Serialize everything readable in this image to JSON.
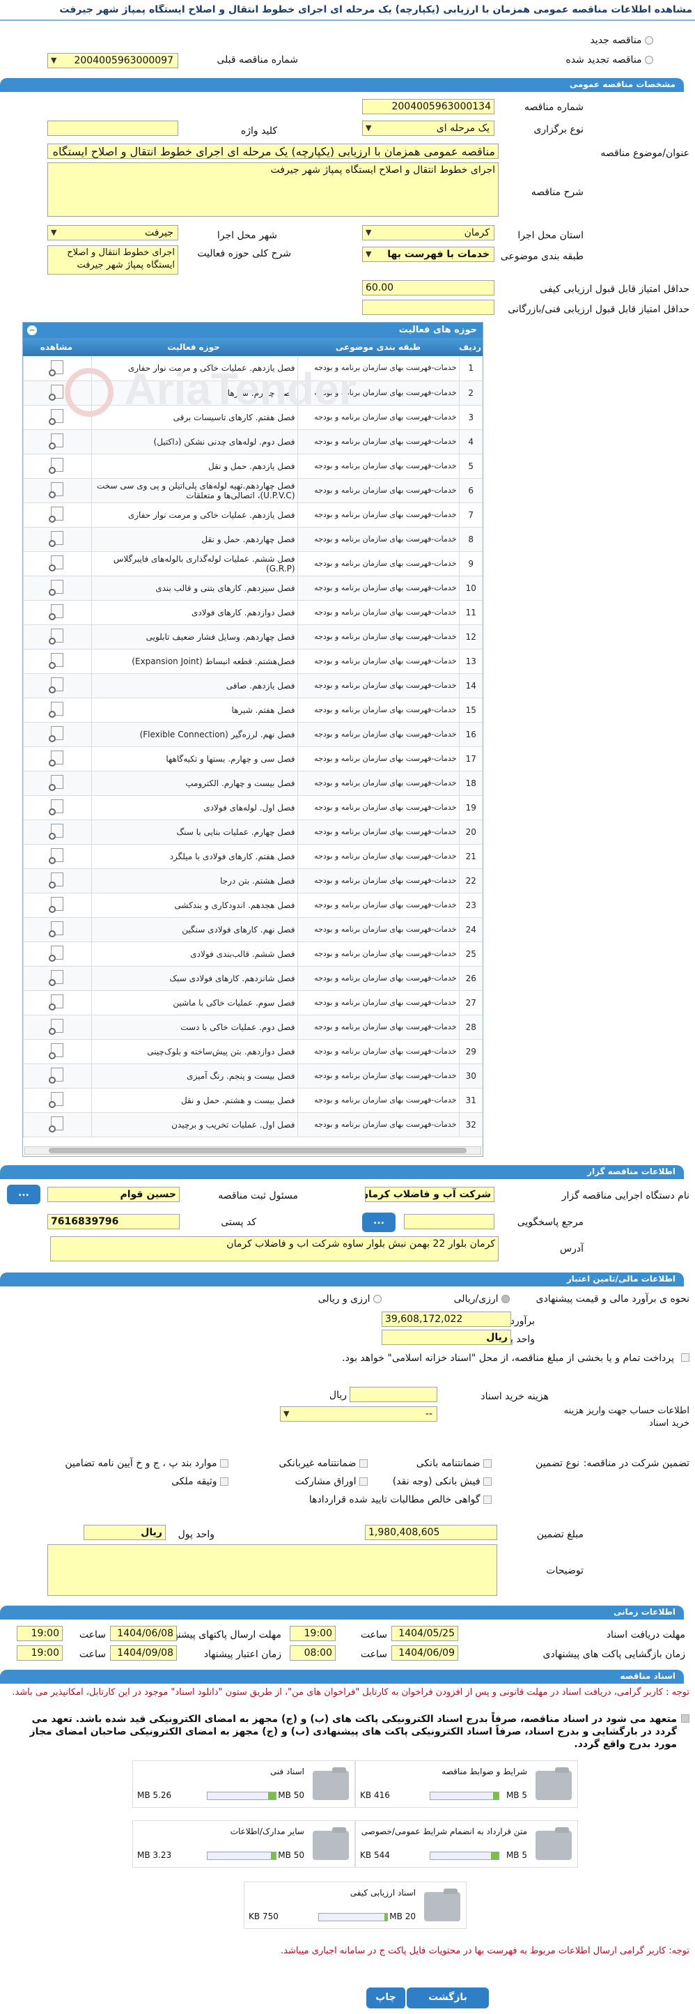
{
  "page_title": "مشاهده اطلاعات مناقصه عمومی همزمان با ارزیابی (یکپارچه) یک مرحله ای اجرای خطوط انتقال و اصلاح ایستگاه پمپاژ شهر جیرفت",
  "top": {
    "new_tender": "مناقصه جدید",
    "renewed_tender": "مناقصه تجدید شده",
    "prev_number_label": "شماره مناقصه قبلی",
    "prev_number_value": "2004005963000097"
  },
  "general": {
    "header": "مشخصات مناقصه عمومی",
    "number_label": "شماره مناقصه",
    "number_value": "2004005963000134",
    "type_label": "نوع برگزاری",
    "type_value": "یک مرحله ای",
    "keyword_label": "کلید واژه",
    "keyword_value": "",
    "title_label": "عنوان/موضوع مناقصه",
    "title_value": "مناقصه عمومی همزمان با ارزیابی (یکپارچه) یک مرحله ای اجرای خطوط انتقال و اصلاح ایستگاه",
    "desc_label": "شرح مناقصه",
    "desc_value": "اجرای خطوط انتقال و اصلاح ایستگاه پمپاژ شهر جیرفت",
    "province_label": "استان محل اجرا",
    "province_value": "کرمان",
    "city_label": "شهر محل اجرا",
    "city_value": "جیرفت",
    "category_label": "طبقه بندی موضوعی",
    "category_value": "خدمات با فهرست بها",
    "scope_label": "شرح کلی حوزه فعالیت",
    "scope_value": "اجرای خطوط انتقال و اصلاح ایستگاه پمپاژ شهر جیرفت",
    "min_quality_label": "حداقل امتیاز قابل قبول ارزیابی کیفی",
    "min_quality_value": "60.00",
    "min_tech_label": "حداقل امتیاز قابل قبول ارزیابی فنی/بازرگانی",
    "min_tech_value": ""
  },
  "activity": {
    "header": "حوزه های فعالیت",
    "col_row": "ردیف",
    "col_cat": "طبقه بندی موضوعی",
    "col_field": "حوزه فعالیت",
    "col_view": "مشاهده",
    "cat_text": "خدمات-فهرست بهای سازمان برنامه و بودجه",
    "rows": [
      {
        "n": "1",
        "f": "فصل یازدهم. عملیات خاکی و مرمت نوار حفاری"
      },
      {
        "n": "2",
        "f": "فصل چهارم. شیرها"
      },
      {
        "n": "3",
        "f": "فصل هفتم. کارهای تاسیسات برقی"
      },
      {
        "n": "4",
        "f": "فصل دوم. لوله‌های چدنی نشکن (داکتیل)"
      },
      {
        "n": "5",
        "f": "فصل یازدهم. حمل و نقل"
      },
      {
        "n": "6",
        "f": "فصل چهاردهم.تهیه لوله‌های پلی‌اتیلن و پی وی سی سخت (U.P.V.C)، اتصالی‌ها و متعلقات"
      },
      {
        "n": "7",
        "f": "فصل یازدهم. عملیات خاکی و مرمت نوار حفاری"
      },
      {
        "n": "8",
        "f": "فصل چهاردهم. حمل و نقل"
      },
      {
        "n": "9",
        "f": "فصل ششم. عملیات لوله‌گذاری بالوله‌های فایبرگلاس (G.R.P)"
      },
      {
        "n": "10",
        "f": "فصل سیزدهم. کارهای بتنی و قالب بندی"
      },
      {
        "n": "11",
        "f": "فصل دوازدهم. کارهای فولادی"
      },
      {
        "n": "12",
        "f": "فصل چهاردهم. وسایل فشار ضعیف تابلویی"
      },
      {
        "n": "13",
        "f": "فصل‌هشتم. قطعه انبساط (Expansion Joint)"
      },
      {
        "n": "14",
        "f": "فصل یازدهم. صافی"
      },
      {
        "n": "15",
        "f": "فصل هفتم. شیرها"
      },
      {
        "n": "16",
        "f": "فصل نهم. لرزه‌گیر (Flexible Connection)"
      },
      {
        "n": "17",
        "f": "فصل سی و چهارم. بستها و تکیه‌گاهها"
      },
      {
        "n": "18",
        "f": "فصل بیست و چهارم. الکترومپ"
      },
      {
        "n": "19",
        "f": "فصل اول. لوله‌های فولادی"
      },
      {
        "n": "20",
        "f": "فصل چهارم. عملیات بنایی با سنگ"
      },
      {
        "n": "21",
        "f": "فصل هفتم. کارهای فولادی با میلگرد"
      },
      {
        "n": "22",
        "f": "فصل هشتم. بتن درجا"
      },
      {
        "n": "23",
        "f": "فصل هجدهم. اندودکاری و بندکشی"
      },
      {
        "n": "24",
        "f": "فصل نهم. کارهای فولادی سنگین"
      },
      {
        "n": "25",
        "f": "فصل ششم. قالب‌بندی فولادی"
      },
      {
        "n": "26",
        "f": "فصل شانزدهم. کارهای فولادی سبک"
      },
      {
        "n": "27",
        "f": "فصل سوم. عملیات خاکی با ماشین"
      },
      {
        "n": "28",
        "f": "فصل دوم. عملیات خاکی با دست"
      },
      {
        "n": "29",
        "f": "فصل دوازدهم. بتن پیش‌ساخته و بلوک‌چینی"
      },
      {
        "n": "30",
        "f": "فصل بیست و پنجم. رنگ آمیزی"
      },
      {
        "n": "31",
        "f": "فصل بیست و هشتم. حمل و نقل"
      },
      {
        "n": "32",
        "f": "فصل اول. عملیات تخریب و برچیدن"
      }
    ]
  },
  "organizer": {
    "header": "اطلاعات مناقصه گزار",
    "org_label": "نام دستگاه اجرایی مناقصه گزار",
    "org_value": "شرکت آب و فاضلاب کرمان",
    "resp_label": "مسئول ثبت مناقصه",
    "resp_value": "حسین قوام",
    "ref_label": "مرجع پاسخگویی",
    "ref_value": "",
    "postal_label": "کد پستی",
    "postal_value": "7616839796",
    "address_label": "آدرس",
    "address_value": "کرمان بلوار 22 بهمن نبش بلوار ساوه شرکت اب و فاضلاب کرمان",
    "dots": "..."
  },
  "finance": {
    "header": "اطلاعات مالی/تامین اعتبار",
    "estimate_label": "نحوه ی برآورد مالی و قیمت پیشنهادی",
    "opt_rial": "ارزی/ریالی",
    "opt_fx": "ارزی و ریالی",
    "budget_label": "برآورد مالی",
    "budget_value": "39,608,172,022",
    "unit_label": "واحد پول",
    "unit_value": "ریال",
    "pay_note": "پرداخت تمام و یا بخشی از مبلغ مناقصه، از محل \"اسناد خزانه اسلامی\" خواهد بود.",
    "doc_cost_label": "هزینه خرید اسناد",
    "doc_cost_unit": "ریال",
    "account_label": "اطلاعات حساب جهت واریز هزینه خرید اسناد",
    "account_value": "--",
    "guarantee_label": "تضمین شرکت در مناقصه:",
    "guarantee_type_label": "نوع تضمین",
    "g1": "ضمانتنامه بانکی",
    "g2": "ضمانتنامه غیربانکی",
    "g3": "موارد بند پ ، ج و خ آیین نامه تضامین",
    "g4": "فیش بانکی (وجه نقد)",
    "g5": "اوراق مشارکت",
    "g6": "وثیقه ملکی",
    "g7": "گواهی خالص مطالبات تایید شده قراردادها",
    "amount_label": "مبلغ تضمین",
    "amount_value": "1,980,408,605",
    "unit2_label": "واحد پول",
    "unit2_value": "ریال",
    "notes_label": "توضیحات"
  },
  "timing": {
    "header": "اطلاعات زمانی",
    "recv_label": "مهلت دریافت اسناد",
    "recv_date": "1404/05/25",
    "recv_time": "19:00",
    "send_label": "مهلت ارسال پاکتهای پیشنهادی",
    "send_date": "1404/06/08",
    "send_time": "19:00",
    "open_label": "زمان بازگشایی پاکت های پیشنهادی",
    "open_date": "1404/06/09",
    "open_time": "08:00",
    "valid_label": "زمان اعتبار پیشنهاد",
    "valid_date": "1404/09/08",
    "valid_time": "19:00",
    "time_word": "ساعت"
  },
  "docs": {
    "header": "اسناد مناقصه",
    "note1": "توجه : کاربر گرامی، دریافت اسناد در مهلت قانونی و پس از افزودن فراخوان به کارتابل \"فراخوان های من\"، از طریق ستون \"دانلود اسناد\" موجود در این کارتابل، امکانپذیر می باشد.",
    "commit": "متعهد می شود در اسناد مناقصه، صرفاً بدرج اسناد الکترونیکی پاکت های (ب) و (ج) مجهز به امضای الکترونیکی قید شده باشد. تعهد می گردد در بارگشایی و بدرج اسناد، صرفاً اسناد الکترونیکی پاکت های پیشنهادی (ب) و (ج) مجهز به امضای الکترونیکی صاحبان امضای مجاز مورد بدرج واقع گردد.",
    "files": [
      {
        "name": "شرایط و ضوابط مناقصه",
        "size": "416 KB",
        "max": "5 MB",
        "fill": 0.08
      },
      {
        "name": "اسناد فنی",
        "size": "5.26 MB",
        "max": "50 MB",
        "fill": 0.11
      },
      {
        "name": "متن قرارداد به انضمام شرایط عمومی/خصوصی",
        "size": "544 KB",
        "max": "5 MB",
        "fill": 0.11
      },
      {
        "name": "سایر مدارک/اطلاعات",
        "size": "3.23 MB",
        "max": "50 MB",
        "fill": 0.07
      },
      {
        "name": "اسناد ارزیابی کیفی",
        "size": "750 KB",
        "max": "20 MB",
        "fill": 0.04
      }
    ],
    "note2": "توجه: کاربر گرامی ارسال اطلاعات مربوط به فهرست بها در محتویات فایل پاکت ج در سامانه اجباری میباشد."
  },
  "buttons": {
    "back": "بازگشت",
    "print": "چاپ"
  },
  "watermark": "AriaTender"
}
